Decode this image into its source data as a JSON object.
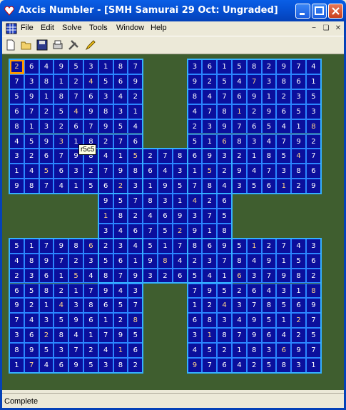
{
  "window": {
    "title": "Axcis Numbler - [SMH Samurai 29 Oct: Ungraded]"
  },
  "menu": [
    "File",
    "Edit",
    "Solve",
    "Tools",
    "Window",
    "Help"
  ],
  "toolbar": [
    "new-icon",
    "open-icon",
    "save-icon",
    "print-icon",
    "tools-icon",
    "pencil-icon"
  ],
  "tooltip": "r5c5",
  "status": "Complete",
  "colors": {
    "cell_bg": "#0b0f9c",
    "cell_border": "#2b86ff",
    "board_bg": "#3f5e2f",
    "selected": "#ff9a00"
  },
  "grids": {
    "top_left": [
      "264953187",
      "738124569",
      "591876342",
      "672549831",
      "813267954",
      "459318276",
      "326798415",
      "145632798",
      "987415623"
    ],
    "top_right": [
      "361582974",
      "925473861",
      "847691235",
      "478129653",
      "239765418",
      "516834792",
      "693218547",
      "152947386",
      "784356129"
    ],
    "center": [
      "415278693",
      "798643152",
      "623195784",
      "957831426",
      "182469375",
      "346752918",
      "234517869",
      "561984237",
      "879326541"
    ],
    "bottom_left": [
      "517986234",
      "489723561",
      "236154879",
      "658217943",
      "921438657",
      "743596128",
      "362841795",
      "895372416",
      "174695382"
    ],
    "bottom_right": [
      "869512743",
      "237849156",
      "541637982",
      "795264318",
      "124378569",
      "683495127",
      "318796425",
      "452183697",
      "976425831"
    ]
  }
}
